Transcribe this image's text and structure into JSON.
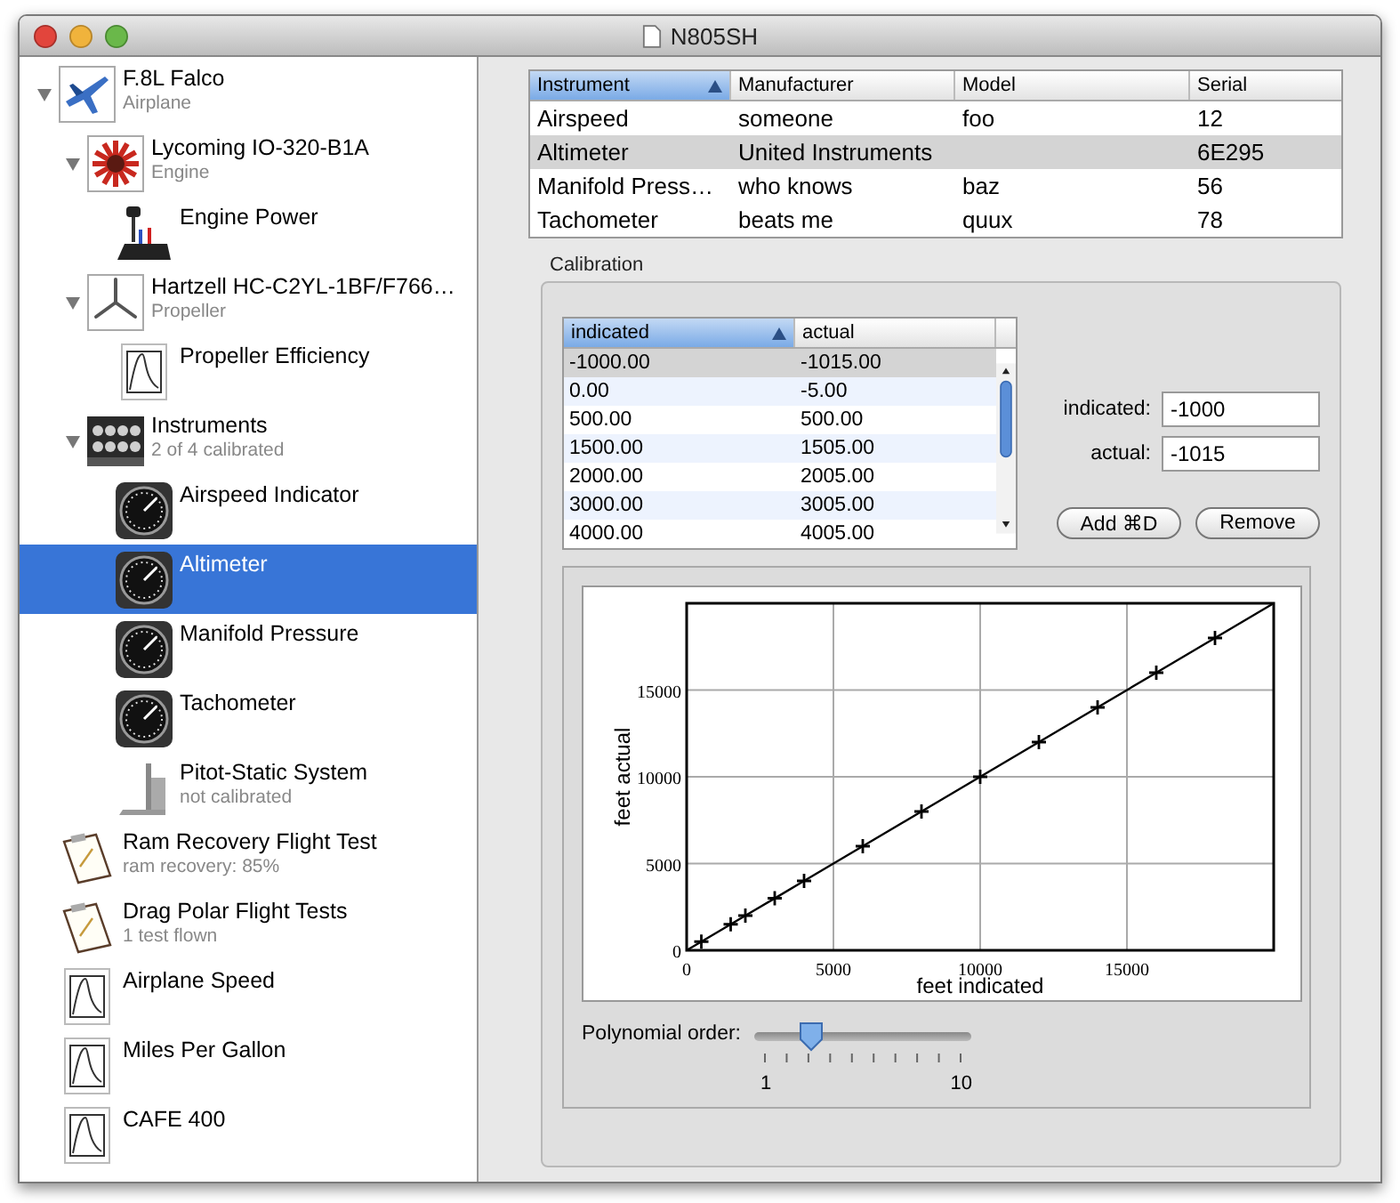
{
  "window": {
    "title": "N805SH"
  },
  "sidebar": {
    "items": [
      {
        "title": "F.8L Falco",
        "subtitle": "Airplane",
        "kind": "airplane",
        "expanded": true,
        "selected": false,
        "children": [
          {
            "title": "Lycoming IO-320-B1A",
            "subtitle": "Engine",
            "kind": "engine",
            "expanded": true,
            "selected": false,
            "children": [
              {
                "title": "Engine Power",
                "kind": "power",
                "selected": false
              }
            ]
          },
          {
            "title": "Hartzell HC-C2YL-1BF/F766…",
            "subtitle": "Propeller",
            "kind": "propeller",
            "expanded": true,
            "selected": false,
            "children": [
              {
                "title": "Propeller Efficiency",
                "kind": "graph",
                "selected": false
              }
            ]
          },
          {
            "title": "Instruments",
            "subtitle": "2 of 4 calibrated",
            "kind": "panel",
            "expanded": true,
            "selected": false,
            "children": [
              {
                "title": "Airspeed Indicator",
                "kind": "gauge",
                "selected": false
              },
              {
                "title": "Altimeter",
                "kind": "gauge",
                "selected": true
              },
              {
                "title": "Manifold Pressure",
                "kind": "gauge",
                "selected": false
              },
              {
                "title": "Tachometer",
                "kind": "gauge",
                "selected": false
              },
              {
                "title": "Pitot-Static System",
                "subtitle": "not calibrated",
                "kind": "pitot",
                "selected": false
              }
            ]
          }
        ]
      },
      {
        "title": "Ram Recovery Flight Test",
        "subtitle": "ram recovery: 85%",
        "kind": "clipboard",
        "selected": false
      },
      {
        "title": "Drag Polar Flight Tests",
        "subtitle": "1 test flown",
        "kind": "clipboard",
        "selected": false
      },
      {
        "title": "Airplane Speed",
        "kind": "graph",
        "selected": false
      },
      {
        "title": "Miles Per Gallon",
        "kind": "graph",
        "selected": false
      },
      {
        "title": "CAFE 400",
        "kind": "graph",
        "selected": false
      }
    ]
  },
  "instruments_table": {
    "columns": [
      {
        "label": "Instrument",
        "sorted": true
      },
      {
        "label": "Manufacturer",
        "sorted": false
      },
      {
        "label": "Model",
        "sorted": false
      },
      {
        "label": "Serial",
        "sorted": false
      }
    ],
    "rows": [
      {
        "cells": [
          "Airspeed",
          "someone",
          "foo",
          "12"
        ],
        "selected": false
      },
      {
        "cells": [
          "Altimeter",
          "United Instruments",
          "",
          "6E295"
        ],
        "selected": true
      },
      {
        "cells": [
          "Manifold Press…",
          "who knows",
          "baz",
          "56"
        ],
        "selected": false
      },
      {
        "cells": [
          "Tachometer",
          "beats me",
          "quux",
          "78"
        ],
        "selected": false
      }
    ]
  },
  "calibration": {
    "title": "Calibration",
    "table": {
      "columns": [
        {
          "label": "indicated",
          "sorted": true
        },
        {
          "label": "actual",
          "sorted": false
        }
      ],
      "rows": [
        {
          "cells": [
            "-1000.00",
            "-1015.00"
          ],
          "selected": true
        },
        {
          "cells": [
            "0.00",
            "-5.00"
          ],
          "selected": false
        },
        {
          "cells": [
            "500.00",
            "500.00"
          ],
          "selected": false
        },
        {
          "cells": [
            "1500.00",
            "1505.00"
          ],
          "selected": false
        },
        {
          "cells": [
            "2000.00",
            "2005.00"
          ],
          "selected": false
        },
        {
          "cells": [
            "3000.00",
            "3005.00"
          ],
          "selected": false
        },
        {
          "cells": [
            "4000.00",
            "4005.00"
          ],
          "selected": false
        }
      ]
    },
    "fields": [
      {
        "label": "indicated:",
        "value": "-1000"
      },
      {
        "label": "actual:",
        "value": "-1015"
      }
    ],
    "buttons": [
      "Add ⌘D",
      "Remove"
    ],
    "chart_data": {
      "type": "scatter",
      "xlabel": "feet indicated",
      "ylabel": "feet actual",
      "x": [
        0,
        500,
        1500,
        2000,
        3000,
        4000,
        6000,
        8000,
        10000,
        12000,
        14000,
        16000,
        18000,
        20000
      ],
      "series": [
        {
          "color": "#000000",
          "values": [
            null,
            500,
            1500,
            2000,
            3000,
            4000,
            6000,
            8000,
            10000,
            12000,
            14000,
            16000,
            18000,
            null
          ]
        },
        {
          "type": "line",
          "color": "#000000",
          "values": [
            0,
            500,
            1500,
            2000,
            3000,
            4000,
            6000,
            8000,
            10000,
            12000,
            14000,
            16000,
            18000,
            20000
          ]
        }
      ],
      "grid": true,
      "xlim": [
        0,
        20000
      ],
      "ylim": [
        0,
        20000
      ],
      "xticks": [
        0,
        5000,
        10000,
        15000
      ],
      "yticks": [
        0,
        5000,
        10000,
        15000
      ]
    },
    "slider": {
      "label": "Polynomial order:",
      "level": 0.222,
      "min_label": "1",
      "max_label": "10"
    }
  }
}
